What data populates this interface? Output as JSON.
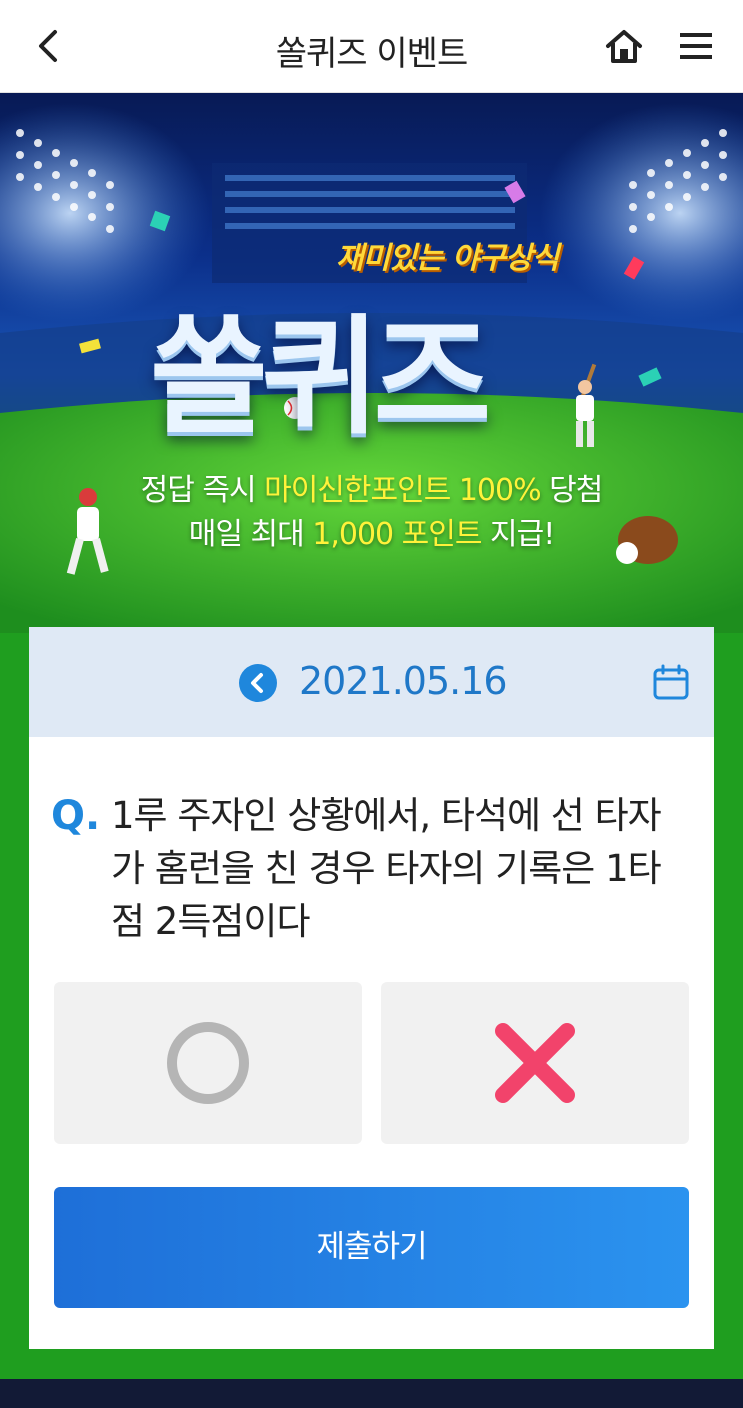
{
  "header": {
    "title": "쏠퀴즈 이벤트"
  },
  "banner": {
    "subtitle": "재미있는 야구상식",
    "logo_text": "쏠퀴즈",
    "line1_prefix": "정답 즉시 ",
    "line1_highlight": "마이신한포인트 100%",
    "line1_suffix": " 당첨",
    "line2_prefix": "매일 최대 ",
    "line2_highlight": "1,000 포인트",
    "line2_suffix": " 지급!"
  },
  "quiz": {
    "date": "2021.05.16",
    "q_label": "Q.",
    "question": "1루 주자인 상황에서, 타석에 선 타자가 홈런을 친 경우 타자의 기록은 1타점 2득점이다",
    "answers": [
      "O",
      "X"
    ],
    "submit_label": "제출하기"
  },
  "colors": {
    "accent": "#1f87dc",
    "correct_icon": "#b5b5b5",
    "wrong_icon": "#f2436b"
  },
  "icons": {
    "back": "chevron-left-icon",
    "home": "home-icon",
    "menu": "hamburger-menu-icon",
    "prev_date": "chevron-left-circle-icon",
    "calendar": "calendar-icon",
    "answer_o": "circle-o-icon",
    "answer_x": "cross-x-icon"
  }
}
